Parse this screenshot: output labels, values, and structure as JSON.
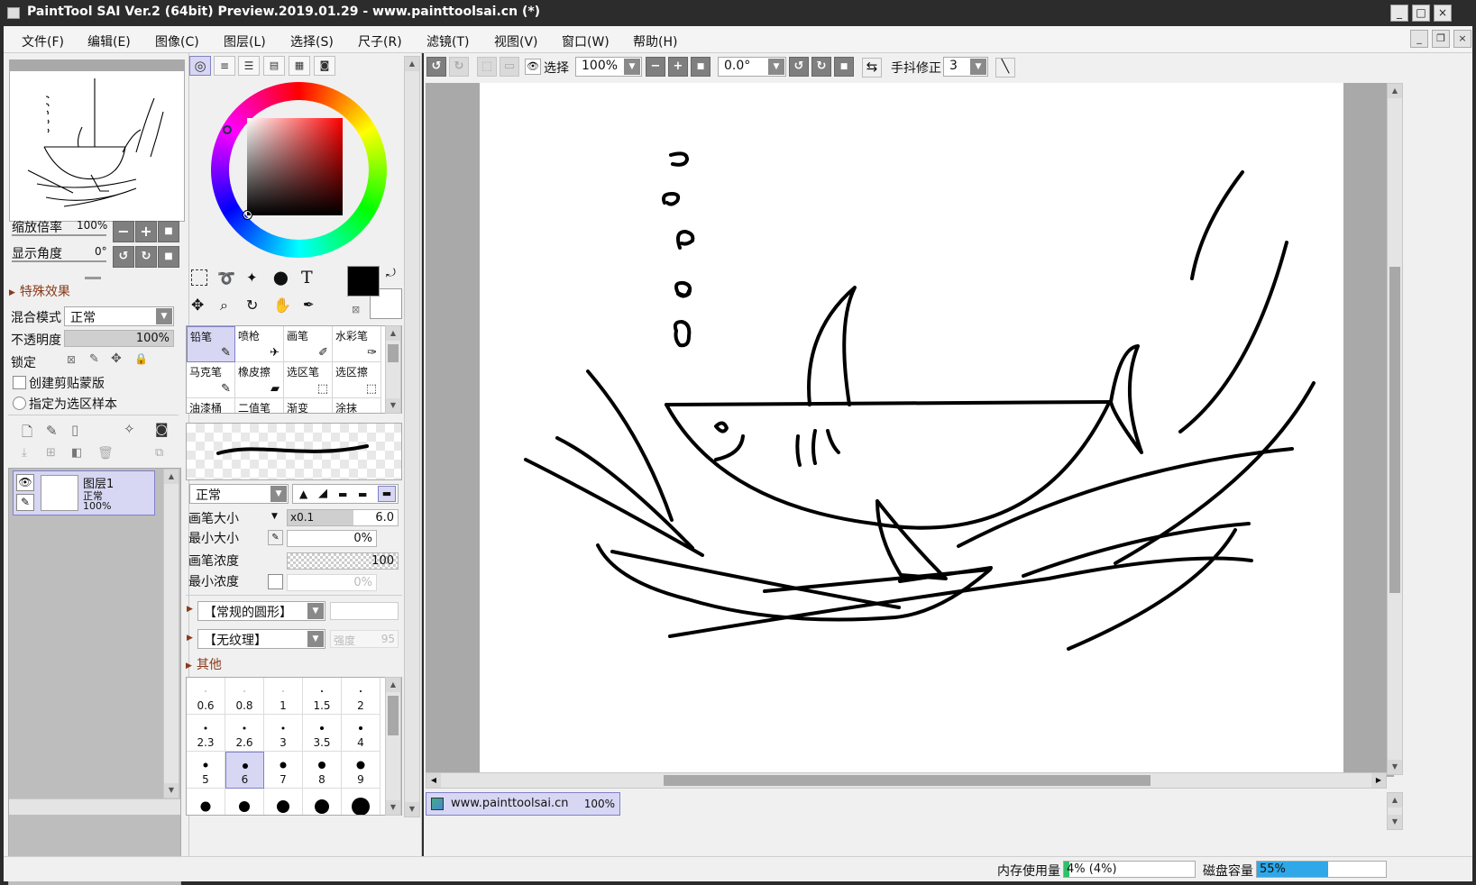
{
  "window": {
    "title": "PaintTool SAI Ver.2 (64bit) Preview.2019.01.29 - www.painttoolsai.cn (*)",
    "buttons": [
      "_",
      "□",
      "×"
    ]
  },
  "menu": {
    "items": [
      "文件(F)",
      "编辑(E)",
      "图像(C)",
      "图层(L)",
      "选择(S)",
      "尺子(R)",
      "滤镜(T)",
      "视图(V)",
      "窗口(W)",
      "帮助(H)"
    ]
  },
  "navigator": {
    "zoom_label": "缩放倍率",
    "zoom_value": "100%",
    "angle_label": "显示角度",
    "angle_value": "0°"
  },
  "layer_props": {
    "section_title": "特殊效果",
    "blend_label": "混合模式",
    "blend_value": "正常",
    "opacity_label": "不透明度",
    "opacity_value": "100%",
    "opacity": 1.0,
    "lock_label": "锁定",
    "clip_label": "创建剪贴蒙版",
    "sample_label": "指定为选区样本"
  },
  "layers": [
    {
      "name": "图层1",
      "mode": "正常",
      "opacity": "100%"
    }
  ],
  "color": {
    "foreground": "#000000",
    "background": "#ffffff"
  },
  "tools_grid": [
    {
      "label": "铅笔",
      "selected": true
    },
    {
      "label": "喷枪",
      "selected": false
    },
    {
      "label": "画笔",
      "selected": false
    },
    {
      "label": "水彩笔",
      "selected": false
    },
    {
      "label": "马克笔",
      "selected": false
    },
    {
      "label": "橡皮擦",
      "selected": false
    },
    {
      "label": "选区笔",
      "selected": false
    },
    {
      "label": "选区擦",
      "selected": false
    },
    {
      "label": "油漆桶",
      "selected": false
    },
    {
      "label": "二值笔",
      "selected": false
    },
    {
      "label": "渐变",
      "selected": false
    },
    {
      "label": "涂抹",
      "selected": false
    }
  ],
  "brush": {
    "mode_value": "正常",
    "size_label": "画笔大小",
    "size_mult": "x0.1",
    "size_value": "6.0",
    "min_size_label": "最小大小",
    "min_size_value": "0%",
    "density_label": "画笔浓度",
    "density_value": "100",
    "min_density_label": "最小浓度",
    "min_density_value": "0%",
    "shape_value": "【常规的圆形】",
    "texture_value": "【无纹理】",
    "texture_strength_label": "强度",
    "texture_strength_value": "95",
    "other_label": "其他"
  },
  "brush_sizes": [
    {
      "n": "0.6",
      "d": 1
    },
    {
      "n": "0.8",
      "d": 1
    },
    {
      "n": "1",
      "d": 1
    },
    {
      "n": "1.5",
      "d": 2
    },
    {
      "n": "2",
      "d": 2
    },
    {
      "n": "2.3",
      "d": 3
    },
    {
      "n": "2.6",
      "d": 3
    },
    {
      "n": "3",
      "d": 3
    },
    {
      "n": "3.5",
      "d": 4
    },
    {
      "n": "4",
      "d": 4
    },
    {
      "n": "5",
      "d": 5
    },
    {
      "n": "6",
      "d": 6
    },
    {
      "n": "7",
      "d": 7
    },
    {
      "n": "8",
      "d": 8
    },
    {
      "n": "9",
      "d": 9
    },
    {
      "n": "",
      "d": 11
    },
    {
      "n": "",
      "d": 12
    },
    {
      "n": "",
      "d": 14
    },
    {
      "n": "",
      "d": 16
    },
    {
      "n": "",
      "d": 20
    }
  ],
  "selected_size": "6",
  "toolbar": {
    "select_label": "选择",
    "zoom_value": "100%",
    "angle_value": "0.0°",
    "stabilizer_label": "手抖修正",
    "stabilizer_value": "3"
  },
  "document_tab": {
    "name": "www.painttoolsai.cn",
    "zoom": "100%"
  },
  "status": {
    "memory_label": "内存使用量",
    "memory_value": "4% (4%)",
    "memory_fraction": 0.04,
    "disk_label": "磁盘容量",
    "disk_value": "55%",
    "disk_fraction": 0.55
  }
}
